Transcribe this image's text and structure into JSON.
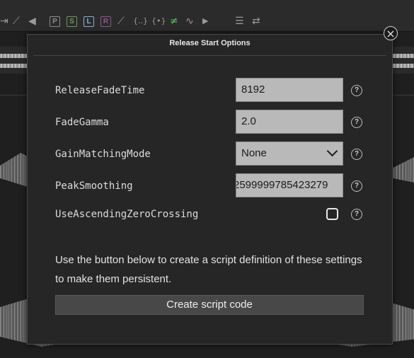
{
  "toolbar": {
    "icons": [
      {
        "name": "skip-end-icon",
        "glyph": "⇥"
      },
      {
        "name": "edit-arrow-icon",
        "glyph": "⟋"
      },
      {
        "name": "speaker-icon",
        "glyph": "◀"
      },
      {
        "name": "p-box",
        "glyph": "P",
        "color": "#8c8c8c"
      },
      {
        "name": "s-box",
        "glyph": "S",
        "color": "#6e9a55"
      },
      {
        "name": "l-box",
        "glyph": "L",
        "color": "#7fb3d5"
      },
      {
        "name": "r-box",
        "glyph": "R",
        "color": "#8a5a8a"
      },
      {
        "name": "curve-icon",
        "glyph": "⟋"
      },
      {
        "name": "braces-dots-icon",
        "glyph": "{..}"
      },
      {
        "name": "braces-plus-icon",
        "glyph": "{•}"
      },
      {
        "name": "no-equal-icon",
        "glyph": "≠"
      },
      {
        "name": "wave-icon",
        "glyph": "∿"
      },
      {
        "name": "play-box-icon",
        "glyph": "▶"
      },
      {
        "name": "indent-icon",
        "glyph": "☰"
      },
      {
        "name": "swap-icon",
        "glyph": "⇄"
      }
    ]
  },
  "dialog": {
    "title": "Release Start Options",
    "close_glyph": "×",
    "help_glyph": "?",
    "rows": [
      {
        "label": "ReleaseFadeTime",
        "value": "8192"
      },
      {
        "label": "FadeGamma",
        "value": "2.0"
      },
      {
        "label": "GainMatchingMode",
        "value": "None"
      },
      {
        "label": "PeakSmoothing",
        "value": "2599999785423279"
      },
      {
        "label": "UseAscendingZeroCrossing",
        "checked": false
      }
    ],
    "description": "Use the button below to create a script definition of these settings to make them persistent.",
    "create_button": "Create script code"
  },
  "colors": {
    "background": "#1f1f1f",
    "dialog_bg": "#262626",
    "field_bg": "#b9b9b9",
    "button_bg": "#484848"
  }
}
